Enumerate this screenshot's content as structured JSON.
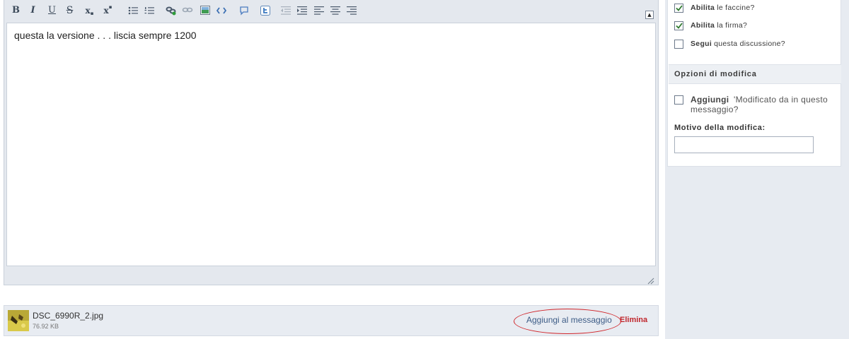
{
  "editor": {
    "toolbar": {
      "bold": "B",
      "italic": "I",
      "underline": "U",
      "strike": "S",
      "subscript": "x",
      "superscript": "x"
    },
    "content": "questa la versione  . . . liscia sempre 1200"
  },
  "attachment": {
    "file_name": "DSC_6990R_2.jpg",
    "file_size": "76.92 KB",
    "add_label": "Aggiungi al messaggio",
    "delete_label": "Elimina"
  },
  "sidebar": {
    "options": [
      {
        "bold": "Abilita",
        "text": "le faccine?",
        "checked": true
      },
      {
        "bold": "Abilita",
        "text": "la firma?",
        "checked": true
      },
      {
        "bold": "Segui",
        "text": "questa discussione?",
        "checked": false
      }
    ],
    "edit_section_title": "Opzioni di modifica",
    "edit_option": {
      "bold": "Aggiungi",
      "text": "'Modificato da in questo messaggio?",
      "checked": false
    },
    "reason_label": "Motivo della modifica:",
    "reason_value": ""
  },
  "colors": {
    "accent_link": "#3d5c86",
    "delete_red": "#c0262c",
    "highlight_oval": "#d0252a"
  }
}
